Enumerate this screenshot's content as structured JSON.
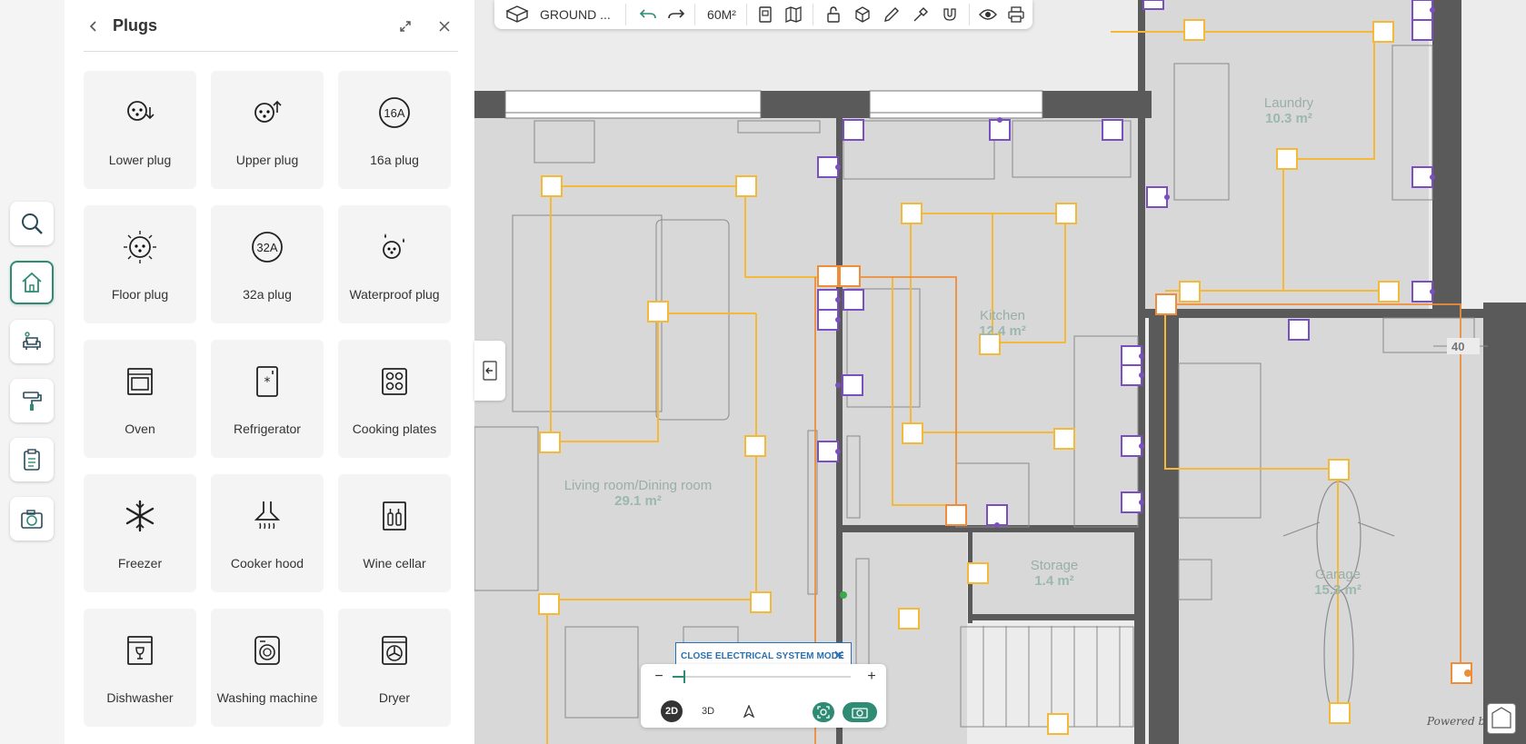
{
  "panel": {
    "title": "Plugs",
    "items": [
      {
        "label": "Lower plug",
        "icon": "lower-plug-icon"
      },
      {
        "label": "Upper plug",
        "icon": "upper-plug-icon"
      },
      {
        "label": "16a plug",
        "icon": "16a-plug-icon"
      },
      {
        "label": "Floor plug",
        "icon": "floor-plug-icon"
      },
      {
        "label": "32a plug",
        "icon": "32a-plug-icon"
      },
      {
        "label": "Waterproof plug",
        "icon": "waterproof-plug-icon"
      },
      {
        "label": "Oven",
        "icon": "oven-icon"
      },
      {
        "label": "Refrigerator",
        "icon": "refrigerator-icon"
      },
      {
        "label": "Cooking plates",
        "icon": "cooking-plates-icon"
      },
      {
        "label": "Freezer",
        "icon": "freezer-icon"
      },
      {
        "label": "Cooker hood",
        "icon": "cooker-hood-icon"
      },
      {
        "label": "Wine cellar",
        "icon": "wine-cellar-icon"
      },
      {
        "label": "Dishwasher",
        "icon": "dishwasher-icon"
      },
      {
        "label": "Washing machine",
        "icon": "washing-machine-icon"
      },
      {
        "label": "Dryer",
        "icon": "dryer-icon"
      }
    ]
  },
  "icon_text": {
    "a16": "16A",
    "a32": "32A"
  },
  "rail": [
    "search-icon",
    "house-icon",
    "furniture-icon",
    "paint-roller-icon",
    "clipboard-icon",
    "camera-icon"
  ],
  "toolbar": {
    "floor_label": "GROUND ...",
    "area_label": "60M²"
  },
  "plan": {
    "rooms": [
      {
        "name": "Living room/Dining room",
        "area": "29.1 m²"
      },
      {
        "name": "Kitchen",
        "area": "12.4 m²"
      },
      {
        "name": "Laundry",
        "area": "10.3 m²"
      },
      {
        "name": "Storage",
        "area": "1.4 m²"
      },
      {
        "name": "Garage",
        "area": "15.3 m²"
      }
    ],
    "dimension": "40",
    "socket_label": "16A"
  },
  "electrical": {
    "close_label": "CLOSE ELECTRICAL SYSTEM MODE"
  },
  "view": {
    "mode_2d": "2D",
    "mode_3d": "3D",
    "zoom_level": 0.06
  },
  "branding": {
    "powered_by": "Powered by"
  },
  "colors": {
    "accent": "#2e8b74",
    "wiring": "#f5b93a",
    "wiring_dark": "#ee8d3a",
    "socket": "#7a4fc0",
    "link": "#2a6fb0"
  }
}
